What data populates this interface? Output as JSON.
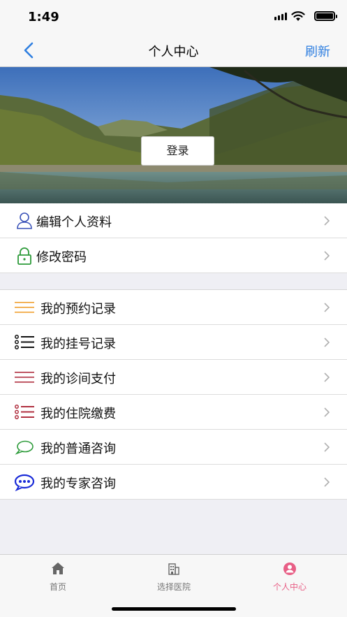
{
  "status_bar": {
    "time": "1:49"
  },
  "nav": {
    "title": "个人中心",
    "refresh_label": "刷新"
  },
  "banner": {
    "login_label": "登录"
  },
  "profile_group": [
    {
      "label": "编辑个人资料",
      "icon": "person-outline-icon"
    },
    {
      "label": "修改密码",
      "icon": "lock-icon"
    }
  ],
  "records_group": [
    {
      "label": "我的预约记录",
      "icon": "lines-orange-icon"
    },
    {
      "label": "我的挂号记录",
      "icon": "bulleted-list-icon"
    },
    {
      "label": "我的诊间支付",
      "icon": "lines-red-icon"
    },
    {
      "label": "我的住院缴费",
      "icon": "bulleted-list-red-icon"
    },
    {
      "label": "我的普通咨询",
      "icon": "chat-bubble-icon"
    },
    {
      "label": "我的专家咨询",
      "icon": "chat-dots-icon"
    }
  ],
  "tabs": [
    {
      "label": "首页",
      "icon": "home-icon",
      "active": false
    },
    {
      "label": "选择医院",
      "icon": "hospital-icon",
      "active": false
    },
    {
      "label": "个人中心",
      "icon": "user-circle-icon",
      "active": true
    }
  ],
  "colors": {
    "accent": "#2f7fe0",
    "tab_active": "#e85f86",
    "background": "#efeff4"
  }
}
